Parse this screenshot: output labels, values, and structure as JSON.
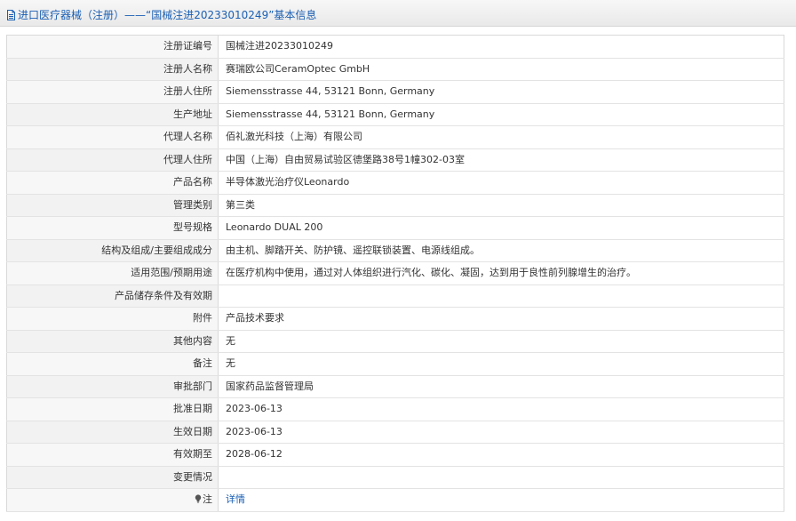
{
  "header": {
    "title": "进口医疗器械（注册）——“国械注进20233010249”基本信息",
    "icon": "document-icon",
    "accent_color": "#1a5fb4"
  },
  "rows": [
    {
      "label": "注册证编号",
      "value": "国械注进20233010249"
    },
    {
      "label": "注册人名称",
      "value": "赛瑞欧公司CeramOptec GmbH"
    },
    {
      "label": "注册人住所",
      "value": "Siemensstrasse 44, 53121 Bonn, Germany"
    },
    {
      "label": "生产地址",
      "value": "Siemensstrasse 44, 53121 Bonn, Germany"
    },
    {
      "label": "代理人名称",
      "value": "佰礼激光科技（上海）有限公司"
    },
    {
      "label": "代理人住所",
      "value": "中国（上海）自由贸易试验区德堡路38号1幢302-03室"
    },
    {
      "label": "产品名称",
      "value": "半导体激光治疗仪Leonardo"
    },
    {
      "label": "管理类别",
      "value": "第三类"
    },
    {
      "label": "型号规格",
      "value": "Leonardo DUAL 200"
    },
    {
      "label": "结构及组成/主要组成成分",
      "value": "由主机、脚踏开关、防护镜、遥控联锁装置、电源线组成。"
    },
    {
      "label": "适用范围/预期用途",
      "value": "在医疗机构中使用，通过对人体组织进行汽化、碳化、凝固，达到用于良性前列腺增生的治疗。"
    },
    {
      "label": "产品储存条件及有效期",
      "value": ""
    },
    {
      "label": "附件",
      "value": "产品技术要求"
    },
    {
      "label": "其他内容",
      "value": "无"
    },
    {
      "label": "备注",
      "value": "无"
    },
    {
      "label": "审批部门",
      "value": "国家药品监督管理局"
    },
    {
      "label": "批准日期",
      "value": "2023-06-13"
    },
    {
      "label": "生效日期",
      "value": "2023-06-13"
    },
    {
      "label": "有效期至",
      "value": "2028-06-12"
    },
    {
      "label": "变更情况",
      "value": ""
    }
  ],
  "note": {
    "label": "注",
    "icon": "lightbulb-icon",
    "link_text": "详情"
  }
}
